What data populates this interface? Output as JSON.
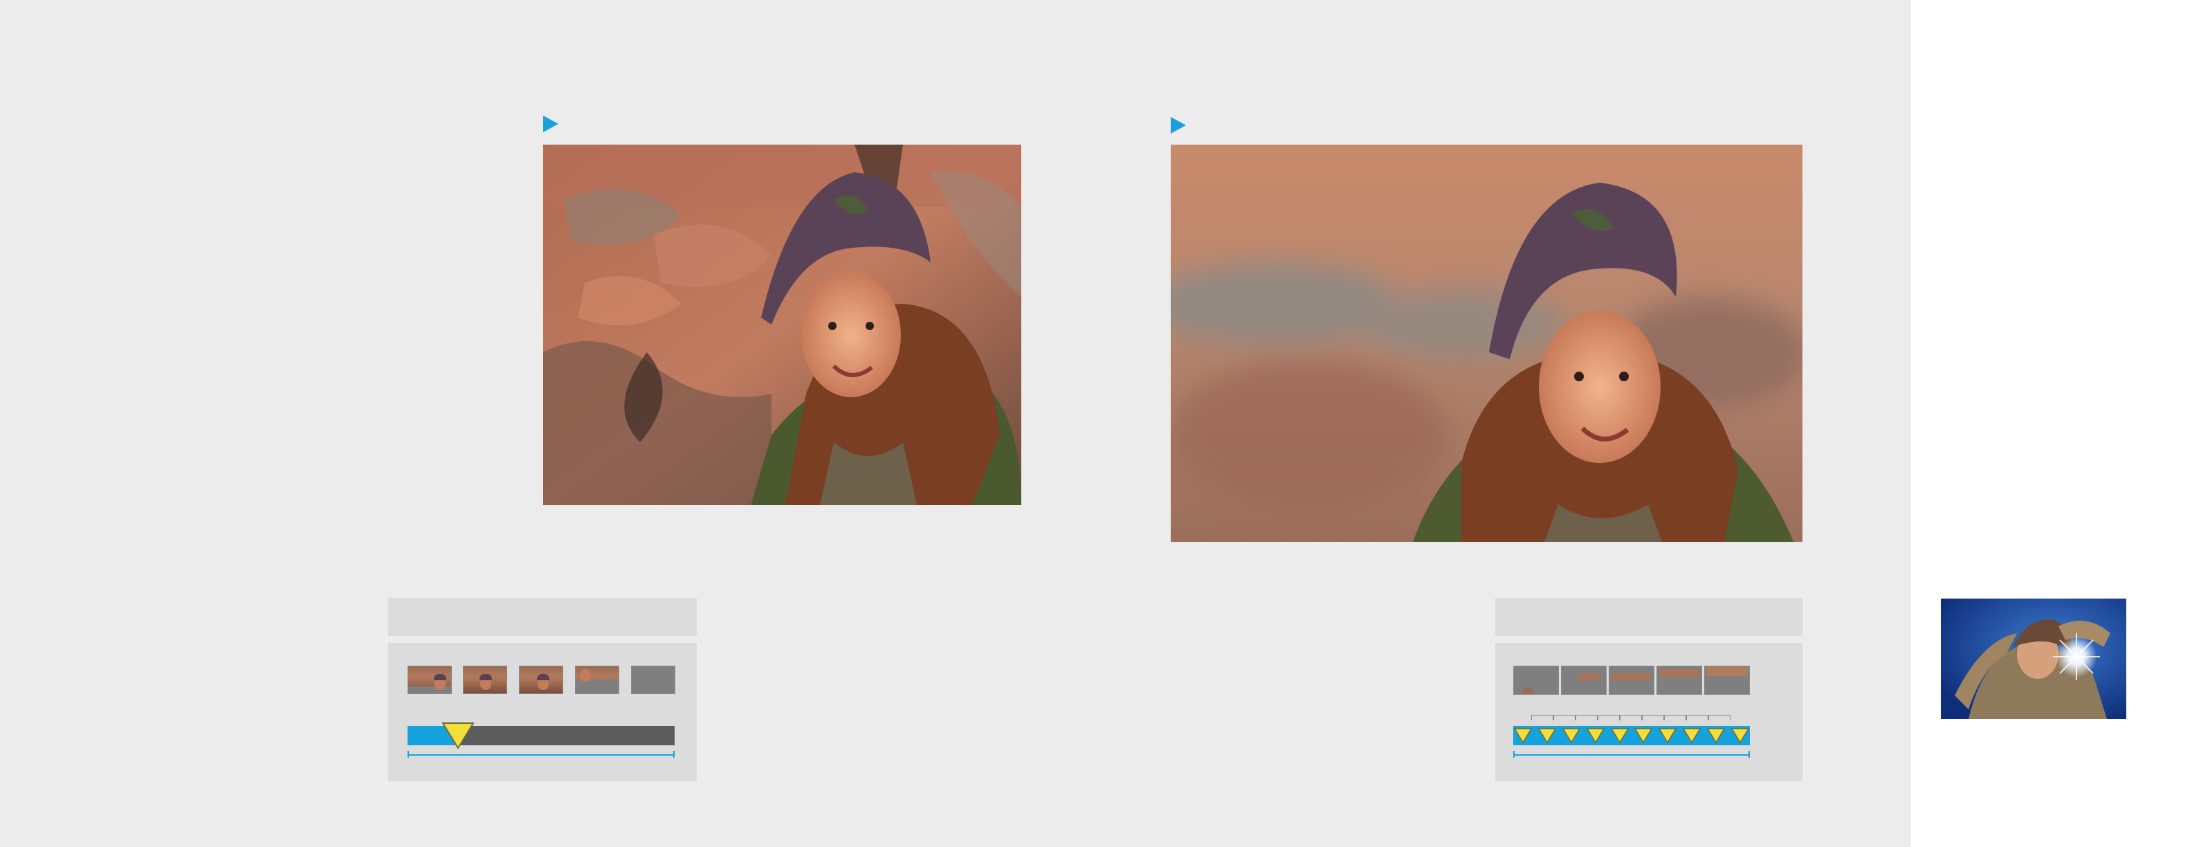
{
  "colors": {
    "background": "#ececec",
    "accent_blue": "#1aa0dc",
    "marker_yellow": "#f2df3a",
    "bar_dark": "#5c5c5e",
    "panel_grey": "#dcdcdd"
  },
  "icons": [
    "play-marker-icon",
    "keyframe-marker-icon"
  ],
  "left_panel": {
    "thumbnails": 5,
    "progress": 0.19,
    "marker_count": 1
  },
  "right_panel": {
    "thumbnails": 5,
    "progress": 1.0,
    "marker_count": 10
  }
}
